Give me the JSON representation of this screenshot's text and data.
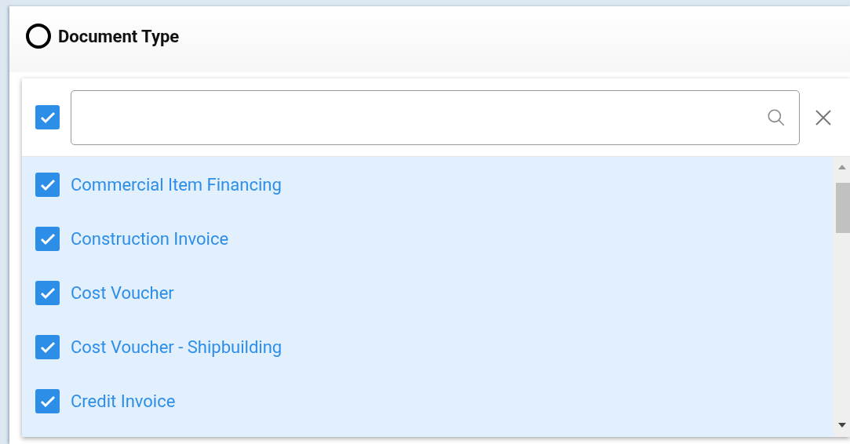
{
  "header": {
    "title": "Document Type"
  },
  "search": {
    "select_all_checked": true
  },
  "options": [
    {
      "label": "Commercial Item Financing",
      "checked": true
    },
    {
      "label": "Construction Invoice",
      "checked": true
    },
    {
      "label": "Cost Voucher",
      "checked": true
    },
    {
      "label": "Cost Voucher - Shipbuilding",
      "checked": true
    },
    {
      "label": "Credit Invoice",
      "checked": true
    }
  ]
}
